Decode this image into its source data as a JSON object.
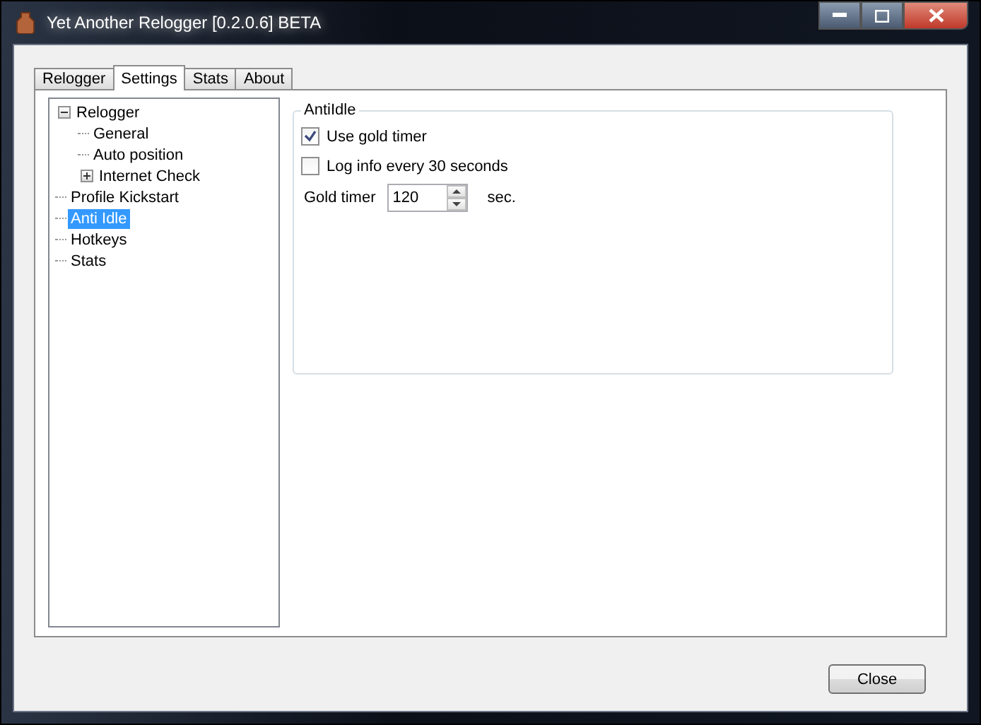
{
  "window": {
    "title": "Yet Another Relogger [0.2.0.6] BETA"
  },
  "tabs": [
    {
      "label": "Relogger",
      "selected": false
    },
    {
      "label": "Settings",
      "selected": true
    },
    {
      "label": "Stats",
      "selected": false
    },
    {
      "label": "About",
      "selected": false
    }
  ],
  "tree": [
    {
      "label": "Relogger",
      "selected": false,
      "expanded": true,
      "children": [
        {
          "label": "General",
          "selected": false
        },
        {
          "label": "Auto position",
          "selected": false
        },
        {
          "label": "Internet Check",
          "selected": false,
          "expanded": false
        }
      ]
    },
    {
      "label": "Profile Kickstart",
      "selected": false
    },
    {
      "label": "Anti Idle",
      "selected": true
    },
    {
      "label": "Hotkeys",
      "selected": false
    },
    {
      "label": "Stats",
      "selected": false
    }
  ],
  "group": {
    "title": "AntiIdle",
    "options": [
      {
        "label": "Use gold timer",
        "checked": true
      },
      {
        "label": "Log info every 30 seconds",
        "checked": false
      }
    ],
    "gold_timer": {
      "label": "Gold timer",
      "value": "120",
      "unit": "sec."
    }
  },
  "buttons": [
    "Close"
  ]
}
